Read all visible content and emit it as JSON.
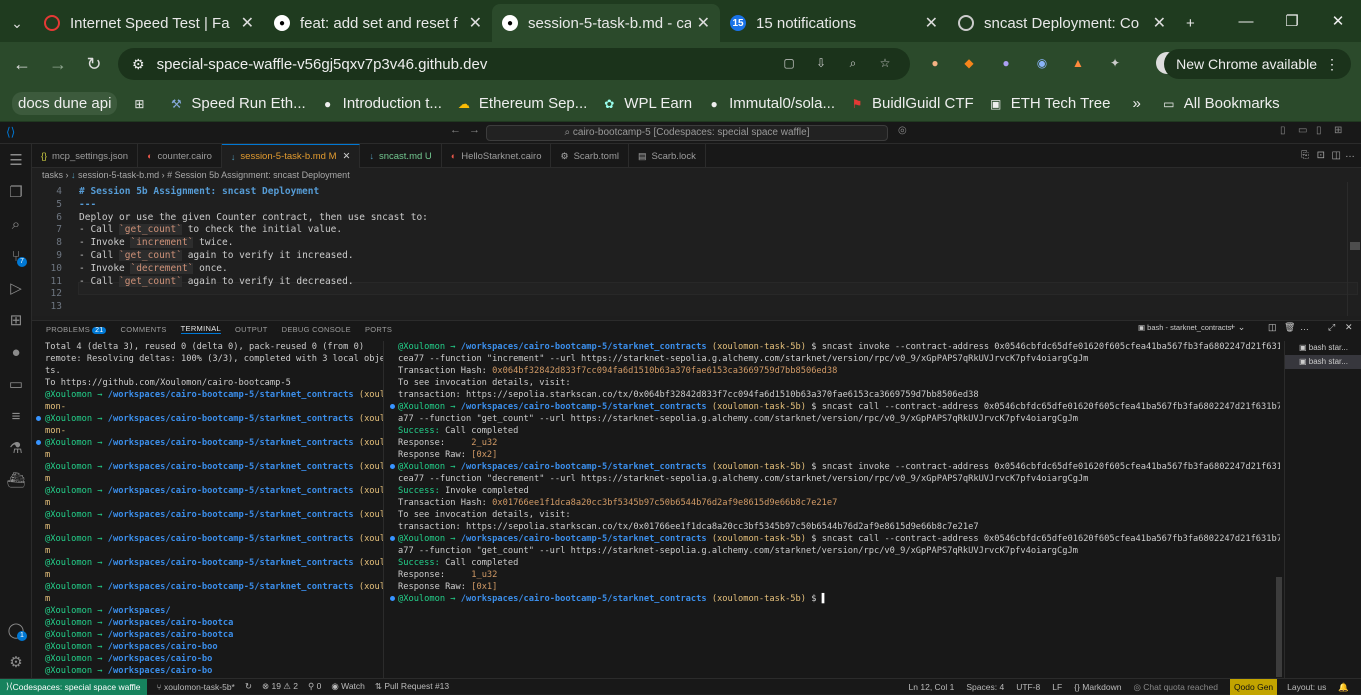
{
  "browser": {
    "tabs": [
      {
        "title": "Internet Speed Test | Fa",
        "icon": "speedometer-icon",
        "color": "#e53935"
      },
      {
        "title": "feat: add set and reset f",
        "icon": "github-icon",
        "color": "#ffffff"
      },
      {
        "title": "session-5-task-b.md - ca",
        "icon": "github-icon",
        "color": "#ffffff"
      },
      {
        "title": "15 notifications",
        "icon": "notification-badge-icon",
        "color": "#1a73e8",
        "badge": "15"
      },
      {
        "title": "sncast Deployment: Co",
        "icon": "starknet-icon",
        "color": "#cccccc"
      }
    ],
    "url": "special-space-waffle-v56gj5qxv7p3v46.github.dev",
    "new_chrome_label": "New Chrome available",
    "bookmarks": [
      {
        "label": "docs dune api",
        "icon": ""
      },
      {
        "label": "Speed Run Eth...",
        "icon": "scaffold-icon"
      },
      {
        "label": "Introduction t...",
        "icon": "github-icon"
      },
      {
        "label": "Ethereum Sep...",
        "icon": "google-cloud-icon"
      },
      {
        "label": "WPL Earn",
        "icon": "wpl-icon"
      },
      {
        "label": "Immutal0/sola...",
        "icon": "github-icon"
      },
      {
        "label": "BuidlGuidl CTF",
        "icon": "flag-icon"
      },
      {
        "label": "ETH Tech Tree",
        "icon": "tree-icon"
      }
    ],
    "all_bookmarks": "All Bookmarks"
  },
  "vscode": {
    "command_center": "cairo-bootcamp-5 [Codespaces: special space waffle]",
    "editor_tabs": [
      {
        "label": "mcp_settings.json",
        "icon": "{}"
      },
      {
        "label": "counter.cairo",
        "icon": "cairo"
      },
      {
        "label": "session-5-task-b.md",
        "suffix": "M",
        "icon": "md",
        "active": true
      },
      {
        "label": "sncast.md",
        "suffix": "U",
        "icon": "md",
        "green": true
      },
      {
        "label": "HelloStarknet.cairo",
        "icon": "cairo"
      },
      {
        "label": "Scarb.toml",
        "icon": "gear"
      },
      {
        "label": "Scarb.lock",
        "icon": "lock"
      }
    ],
    "breadcrumb": [
      "tasks",
      "session-5-task-b.md",
      "# Session 5b Assignment: sncast Deployment"
    ],
    "editor_lines": [
      {
        "n": "4",
        "text": "# Session 5b Assignment: sncast Deployment",
        "kind": "heading"
      },
      {
        "n": "5",
        "text": "---",
        "kind": "heading"
      },
      {
        "n": "6",
        "text": "Deploy or use the given Counter contract, then use sncast to:",
        "kind": "plain"
      },
      {
        "n": "7",
        "pre": "- Call ",
        "code": "`get_count`",
        "post": " to check the initial value.",
        "kind": "code"
      },
      {
        "n": "8",
        "pre": "- Invoke ",
        "code": "`increment`",
        "post": " twice.",
        "kind": "code"
      },
      {
        "n": "9",
        "pre": "- Call ",
        "code": "`get_count`",
        "post": " again to verify it increased.",
        "kind": "code"
      },
      {
        "n": "10",
        "pre": "- Invoke ",
        "code": "`decrement`",
        "post": " once.",
        "kind": "code"
      },
      {
        "n": "11",
        "pre": "- Call ",
        "code": "`get_count`",
        "post": " again to verify it decreased.",
        "kind": "code"
      },
      {
        "n": "12",
        "text": "",
        "kind": "plain"
      },
      {
        "n": "13",
        "text": "",
        "kind": "plain"
      }
    ],
    "panel_tabs": {
      "problems": "PROBLEMS",
      "problems_count": "21",
      "comments": "COMMENTS",
      "terminal": "TERMINAL",
      "output": "OUTPUT",
      "debug": "DEBUG CONSOLE",
      "ports": "PORTS"
    },
    "terminal_name": "bash - starknet_contracts",
    "terminal_list": [
      "bash star...",
      "bash star..."
    ],
    "status": {
      "remote": "Codespaces: special space waffle",
      "branch": "xoulomon-task-5b*",
      "sync": "↻",
      "errors": "⊗ 19 ⚠ 2",
      "ports": "⚲ 0",
      "watch": "Watch",
      "pr": "Pull Request #13",
      "position": "Ln 12, Col 1",
      "spaces": "Spaces: 4",
      "encoding": "UTF-8",
      "eol": "LF",
      "lang": "Markdown",
      "chat": "Chat quota reached",
      "qodo": "Qodo Gen",
      "layout": "Layout: us"
    }
  },
  "terminal_left": [
    {
      "t": "Total 4 (delta 3), reused 0 (delta 0), pack-reused 0 (from 0)"
    },
    {
      "t": "remote: Resolving deltas: 100% (3/3), completed with 3 local objec"
    },
    {
      "t": "ts."
    },
    {
      "t": "To https://github.com/Xoulomon/cairo-bootcamp-5"
    },
    {
      "p": "@Xoulomon",
      "path": "/workspaces/cairo-bootcamp-5/starknet_contracts",
      "br": "(xoulo",
      "dot": false
    },
    {
      "br2": "mon-"
    },
    {
      "p": "@Xoulomon",
      "path": "/workspaces/cairo-bootcamp-5/starknet_contracts",
      "br": "(xoulo",
      "dot": true
    },
    {
      "br2": "mon-"
    },
    {
      "p": "@Xoulomon",
      "path": "/workspaces/cairo-bootcamp-5/starknet_contracts",
      "br": "(xoulo",
      "dot": true
    },
    {
      "br2": "m"
    },
    {
      "p": "@Xoulomon",
      "path": "/workspaces/cairo-bootcamp-5/starknet_contracts",
      "br": "(xoulo",
      "dot": false
    },
    {
      "br2": "m"
    },
    {
      "p": "@Xoulomon",
      "path": "/workspaces/cairo-bootcamp-5/starknet_contracts",
      "br": "(xoulo",
      "dot": false
    },
    {
      "br2": "m"
    },
    {
      "p": "@Xoulomon",
      "path": "/workspaces/cairo-bootcamp-5/starknet_contracts",
      "br": "(xoulo",
      "dot": false
    },
    {
      "br2": "m"
    },
    {
      "p": "@Xoulomon",
      "path": "/workspaces/cairo-bootcamp-5/starknet_contracts",
      "br": "(xoulo",
      "dot": false
    },
    {
      "br2": "m"
    },
    {
      "p": "@Xoulomon",
      "path": "/workspaces/cairo-bootcamp-5/starknet_contracts",
      "br": "(xoulo",
      "dot": false
    },
    {
      "br2": "m"
    },
    {
      "p": "@Xoulomon",
      "path": "/workspaces/cairo-bootcamp-5/starknet_contracts",
      "br": "(xoulo",
      "dot": false
    },
    {
      "br2": "m"
    },
    {
      "p": "@Xoulomon",
      "path": "/workspaces/",
      "br": "",
      "dot": false
    },
    {
      "p": "@Xoulomon",
      "path": "/workspaces/cairo-bootca",
      "br": "",
      "dot": false
    },
    {
      "p": "@Xoulomon",
      "path": "/workspaces/cairo-bootca",
      "br": "",
      "dot": false
    },
    {
      "p": "@Xoulomon",
      "path": "/workspaces/cairo-boo",
      "br": "",
      "dot": false
    },
    {
      "p": "@Xoulomon",
      "path": "/workspaces/cairo-bo",
      "br": "",
      "dot": false
    },
    {
      "p": "@Xoulomon",
      "path": "/workspaces/cairo-bo",
      "br": "",
      "dot": false
    }
  ],
  "terminal_right": [
    {
      "p": "@Xoulomon",
      "path": "/workspaces/cairo-bootcamp-5/starknet_contracts",
      "br": "(xoulomon-task-5b)",
      "cmd": " $ sncast invoke --contract-address 0x0546cbfdc65dfe01620f605cfea41ba567fb3fa6802247d21f631b7f8ef"
    },
    {
      "t": "cea77 --function \"increment\" --url https://starknet-sepolia.g.alchemy.com/starknet/version/rpc/v0_9/xGpPAPS7qRkUVJrvcK7pfv4oiargCgJm"
    },
    {
      "t": ""
    },
    {
      "label": "Transaction Hash: ",
      "hash": "0x064bf32842d833f7cc094fa6d1510b63a370fae6153ca3669759d7bb8506ed38"
    },
    {
      "t": ""
    },
    {
      "t": "To see invocation details, visit:"
    },
    {
      "t": "transaction: https://sepolia.starkscan.co/tx/0x064bf32842d833f7cc094fa6d1510b63a370fae6153ca3669759d7bb8506ed38"
    },
    {
      "p": "@Xoulomon",
      "path": "/workspaces/cairo-bootcamp-5/starknet_contracts",
      "br": "(xoulomon-task-5b)",
      "cmd": " $ sncast call --contract-address 0x0546cbfdc65dfe01620f605cfea41ba567fb3fa6802247d21f631b7f8efce",
      "dot": true
    },
    {
      "t": "a77 --function \"get_count\" --url https://starknet-sepolia.g.alchemy.com/starknet/version/rpc/v0_9/xGpPAPS7qRkUVJrvcK7pfv4oiargCgJm"
    },
    {
      "ok": "Success: ",
      "rest": "Call completed"
    },
    {
      "t": ""
    },
    {
      "label": "Response:     ",
      "hash": "2_u32"
    },
    {
      "label": "Response Raw: ",
      "hash": "[0x2]"
    },
    {
      "p": "@Xoulomon",
      "path": "/workspaces/cairo-bootcamp-5/starknet_contracts",
      "br": "(xoulomon-task-5b)",
      "cmd": " $ sncast invoke --contract-address 0x0546cbfdc65dfe01620f605cfea41ba567fb3fa6802247d21f631b7f8ef",
      "dot": true
    },
    {
      "t": "cea77 --function \"decrement\" --url https://starknet-sepolia.g.alchemy.com/starknet/version/rpc/v0_9/xGpPAPS7qRkUVJrvcK7pfv4oiargCgJm"
    },
    {
      "ok": "Success: ",
      "rest": "Invoke completed"
    },
    {
      "t": ""
    },
    {
      "label": "Transaction Hash: ",
      "hash": "0x01766ee1f1dca8a20cc3bf5345b97c50b6544b76d2af9e8615d9e66b8c7e21e7"
    },
    {
      "t": ""
    },
    {
      "t": "To see invocation details, visit:"
    },
    {
      "t": "transaction: https://sepolia.starkscan.co/tx/0x01766ee1f1dca8a20cc3bf5345b97c50b6544b76d2af9e8615d9e66b8c7e21e7"
    },
    {
      "p": "@Xoulomon",
      "path": "/workspaces/cairo-bootcamp-5/starknet_contracts",
      "br": "(xoulomon-task-5b)",
      "cmd": " $ sncast call --contract-address 0x0546cbfdc65dfe01620f605cfea41ba567fb3fa6802247d21f631b7f8efce",
      "dot": true
    },
    {
      "t": "a77 --function \"get_count\" --url https://starknet-sepolia.g.alchemy.com/starknet/version/rpc/v0_9/xGpPAPS7qRkUVJrvcK7pfv4oiargCgJm"
    },
    {
      "ok": "Success: ",
      "rest": "Call completed"
    },
    {
      "t": ""
    },
    {
      "label": "Response:     ",
      "hash": "1_u32"
    },
    {
      "label": "Response Raw: ",
      "hash": "[0x1]"
    },
    {
      "p": "@Xoulomon",
      "path": "/workspaces/cairo-bootcamp-5/starknet_contracts",
      "br": "(xoulomon-task-5b)",
      "cmd": " $ ",
      "dot": true,
      "cursor": true
    }
  ]
}
